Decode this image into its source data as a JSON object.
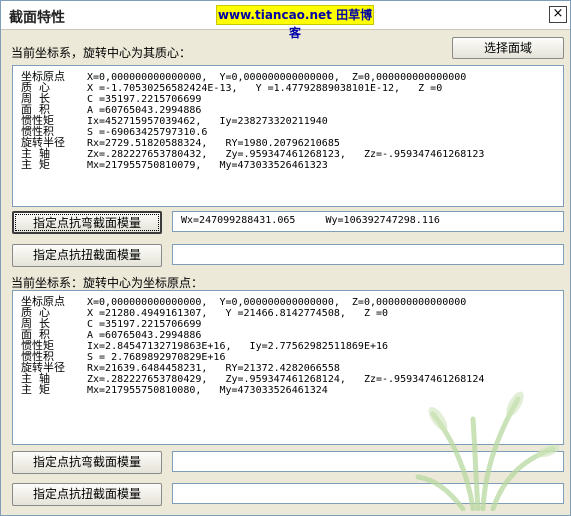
{
  "window": {
    "title": "截面特性",
    "watermark": "www.tiancao.net 田草博客",
    "close_glyph": "×"
  },
  "select_button_label": "选择面域",
  "section1": {
    "label": "当前坐标系，旋转中心为其质心：",
    "rows": [
      {
        "label": "坐标原点",
        "value": "X=0,000000000000000,  Y=0,000000000000000,  Z=0,000000000000000"
      },
      {
        "label": "质  心",
        "value": "X =-1.70530256582424E-13,   Y =1.47792889038101E-12,   Z =0"
      },
      {
        "label": "周  长",
        "value": "C =35197.2215706699"
      },
      {
        "label": "面  积",
        "value": "A =60765043.2994886"
      },
      {
        "label": "惯性矩",
        "value": "Ix=452715957039462,   Iy=238273320211940"
      },
      {
        "label": "惯性积",
        "value": "S =-69063425797310.6"
      },
      {
        "label": "旋转半径",
        "value": "Rx=2729.51820588324,   RY=1980.20796210685"
      },
      {
        "label": "主  轴",
        "value": "Zx=.282227653780432,   Zy=.959347461268123,   Zz=-.959347461268123"
      },
      {
        "label": "主  矩",
        "value": "Mx=217955750810079,   My=473033526461323"
      }
    ],
    "bend_button": "指定点抗弯截面模量",
    "bend_value": "Wx=247099288431.065     Wy=106392747298.116",
    "torsion_button": "指定点抗扭截面模量",
    "torsion_value": ""
  },
  "section2": {
    "label": "当前坐标系：旋转中心为坐标原点：",
    "rows": [
      {
        "label": "坐标原点",
        "value": "X=0,000000000000000,  Y=0,000000000000000,  Z=0,000000000000000"
      },
      {
        "label": "质  心",
        "value": "X =21280.4949161307,   Y =21466.8142774508,   Z =0"
      },
      {
        "label": "周  长",
        "value": "C =35197.2215706699"
      },
      {
        "label": "面  积",
        "value": "A =60765043.2994886"
      },
      {
        "label": "惯性矩",
        "value": "Ix=2.84547132719863E+16,   Iy=2.77562982511869E+16"
      },
      {
        "label": "惯性积",
        "value": "S = 2.7689892970829E+16"
      },
      {
        "label": "旋转半径",
        "value": "Rx=21639.6484458231,   RY=21372.4282066558"
      },
      {
        "label": "主  轴",
        "value": "Zx=.282227653780429,   Zy=.959347461268124,   Zz=-.959347461268124"
      },
      {
        "label": "主  矩",
        "value": "Mx=217955750810080,   My=473033526461324"
      }
    ],
    "bend_button": "指定点抗弯截面模量",
    "bend_value": "",
    "torsion_button": "指定点抗扭截面模量",
    "torsion_value": ""
  }
}
